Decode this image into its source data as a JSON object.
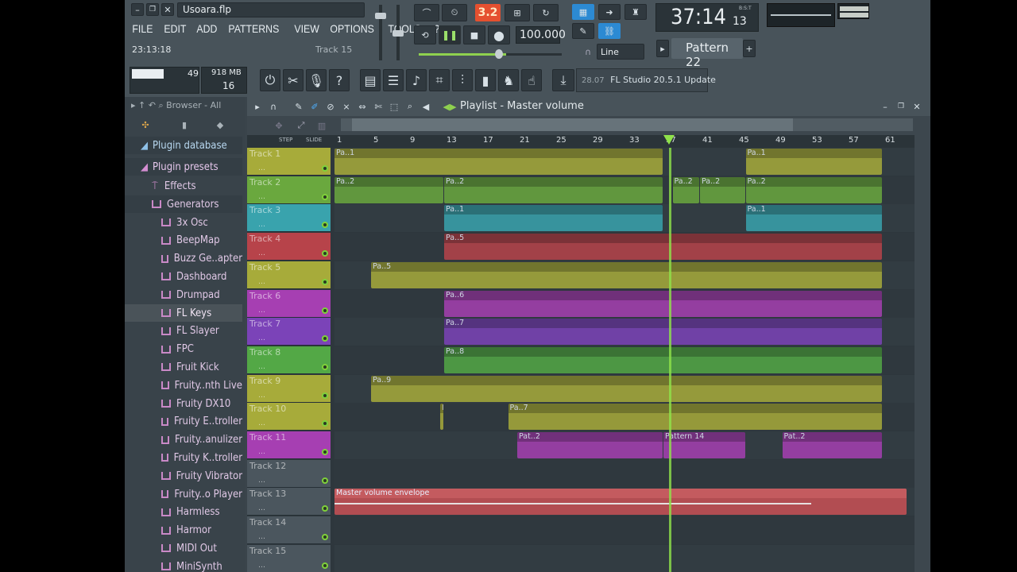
{
  "window": {
    "filename": "Usoara.flp",
    "time_display": "23:13:18",
    "track_label": "Track 15"
  },
  "menu": [
    "FILE",
    "EDIT",
    "ADD",
    "PATTERNS",
    "VIEW",
    "OPTIONS",
    "TOOLS",
    "?"
  ],
  "transport": {
    "bpm": "100.000",
    "pattern_mode": "3.2"
  },
  "song_time": {
    "main": "37:14",
    "sub": "13",
    "unit": "B:S:T"
  },
  "snap": {
    "value": "Line"
  },
  "pattern": {
    "name": "Pattern 22"
  },
  "cpu": {
    "value": "49",
    "memory": "918 MB",
    "polyphony": "16"
  },
  "news": {
    "version": "28.07",
    "text": "FL Studio 20.5.1 Update"
  },
  "browser": {
    "header": "Browser - All",
    "sections": [
      {
        "label": "Plugin database"
      },
      {
        "label": "Plugin presets"
      }
    ],
    "folders": [
      {
        "label": "Effects"
      },
      {
        "label": "Generators"
      }
    ],
    "items": [
      "3x Osc",
      "BeepMap",
      "Buzz Ge..apter",
      "Dashboard",
      "Drumpad",
      "FL Keys",
      "FL Slayer",
      "FPC",
      "Fruit Kick",
      "Fruity..nth Live",
      "Fruity DX10",
      "Fruity E..troller",
      "Fruity..anulizer",
      "Fruity K..troller",
      "Fruity Vibrator",
      "Fruity..o Player",
      "Harmless",
      "Harmor",
      "MIDI Out",
      "MiniSynth"
    ],
    "selected": "FL Keys"
  },
  "playlist": {
    "title": "Playlist - Master volume",
    "ruler": [
      "1",
      "5",
      "9",
      "13",
      "17",
      "21",
      "25",
      "29",
      "33",
      "37",
      "41",
      "45",
      "49",
      "53",
      "57",
      "61"
    ],
    "tracks": [
      {
        "name": "Track 1",
        "color": "#a7ab3a"
      },
      {
        "name": "Track 2",
        "color": "#6aa83e"
      },
      {
        "name": "Track 3",
        "color": "#39a3ad"
      },
      {
        "name": "Track 4",
        "color": "#b7434a"
      },
      {
        "name": "Track 5",
        "color": "#a7ab3a"
      },
      {
        "name": "Track 6",
        "color": "#a63fb2"
      },
      {
        "name": "Track 7",
        "color": "#7b43b8"
      },
      {
        "name": "Track 8",
        "color": "#53a846"
      },
      {
        "name": "Track 9",
        "color": "#a7ab3a"
      },
      {
        "name": "Track 10",
        "color": "#a7ab3a"
      },
      {
        "name": "Track 11",
        "color": "#a63fb2"
      },
      {
        "name": "Track 12",
        "color": "#4b565e"
      },
      {
        "name": "Track 13",
        "color": "#4b565e"
      },
      {
        "name": "Track 14",
        "color": "#4b565e"
      },
      {
        "name": "Track 15",
        "color": "#4b565e"
      }
    ],
    "automation_clip": "Master volume envelope",
    "clip_labels": {
      "t1": "Pa..1",
      "t2": "Pa..2",
      "t3": "Pa..1",
      "t4": "Pa..5",
      "t5": "Pa..5",
      "t6": "Pa..6",
      "t7": "Pa..7",
      "t8": "Pa..8",
      "t9": "Pa..9",
      "t10": "Pa..7",
      "t11": "Pat..2",
      "t11b": "Pattern 14"
    }
  }
}
